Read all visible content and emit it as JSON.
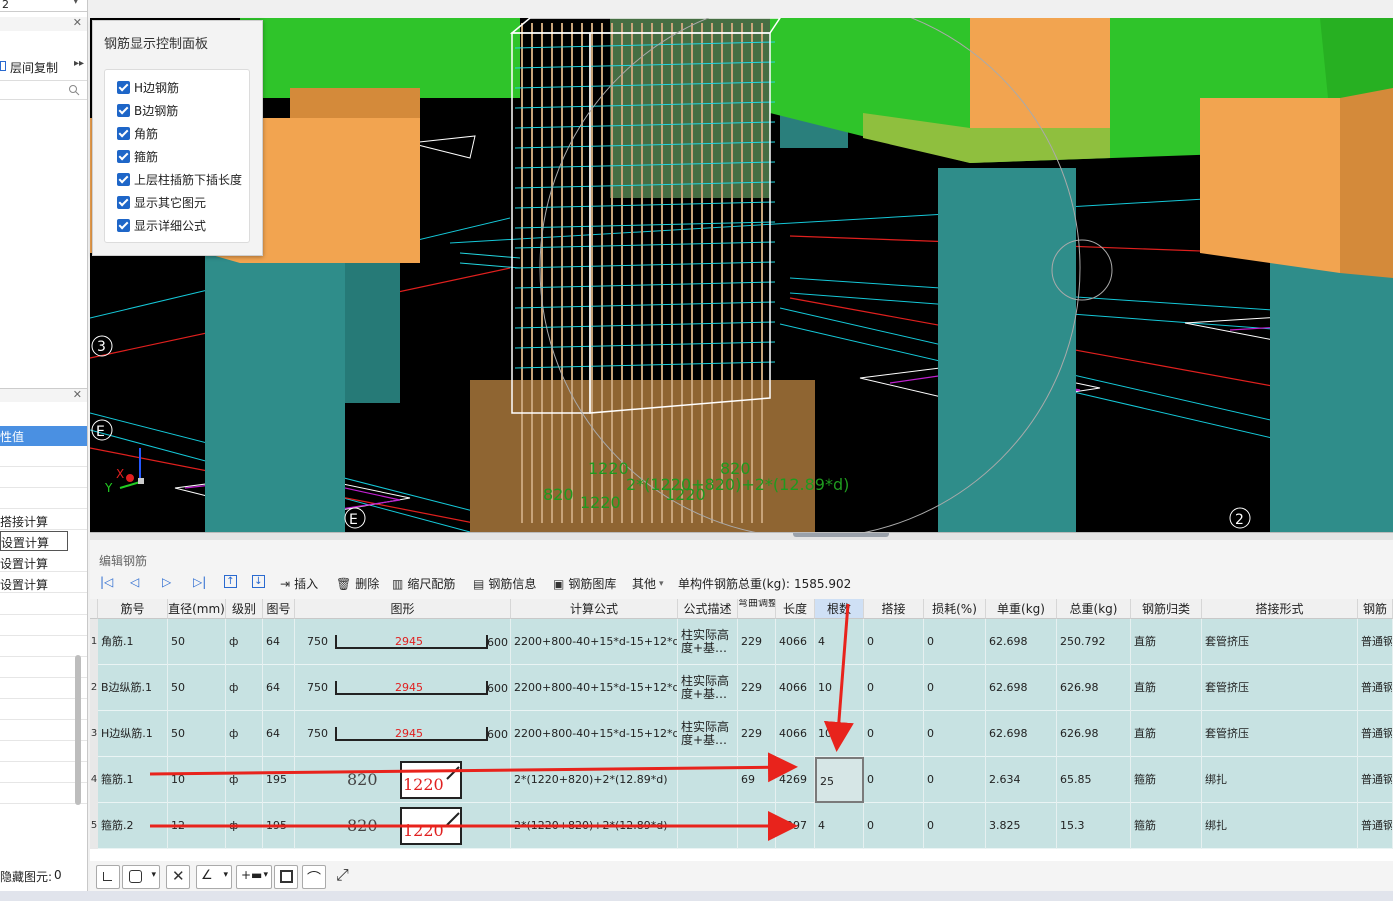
{
  "left_panel": {
    "top_select_value": "2",
    "floor_copy_label": "层间复制",
    "prop_header": "性值",
    "prop_items": [
      "搭接计算",
      "设置计算",
      "设置计算",
      "设置计算"
    ],
    "hidden_elements_label": "隐藏图元:",
    "hidden_elements_count": "0"
  },
  "viewport": {
    "axis_labels": [
      "3",
      "E",
      "E",
      "2"
    ],
    "dimension_labels": [
      "1220",
      "820",
      "820",
      "1220",
      "1220",
      "2*(1220+820)+2*(12.89*d)"
    ],
    "gizmo": {
      "x": "X",
      "y": "Y"
    }
  },
  "control_panel": {
    "title": "钢筋显示控制面板",
    "options": [
      {
        "label": "H边钢筋",
        "checked": true
      },
      {
        "label": "B边钢筋",
        "checked": true
      },
      {
        "label": "角筋",
        "checked": true
      },
      {
        "label": "箍筋",
        "checked": true
      },
      {
        "label": "上层柱插筋下插长度",
        "checked": true
      },
      {
        "label": "显示其它图元",
        "checked": true
      },
      {
        "label": "显示详细公式",
        "checked": true
      }
    ]
  },
  "editor": {
    "title": "编辑钢筋",
    "toolbar": {
      "insert": "插入",
      "delete": "删除",
      "scale_rebar": "缩尺配筋",
      "rebar_info": "钢筋信息",
      "rebar_library": "钢筋图库",
      "other": "其他",
      "total_weight_label": "单构件钢筋总重(kg):",
      "total_weight_value": "1585.902"
    },
    "columns": [
      "筋号",
      "直径(mm)",
      "级别",
      "图号",
      "图形",
      "计算公式",
      "公式描述",
      "弯曲调整",
      "长度",
      "根数",
      "搭接",
      "损耗(%)",
      "单重(kg)",
      "总重(kg)",
      "钢筋归类",
      "搭接形式",
      "钢筋"
    ],
    "rows": [
      {
        "no": "1",
        "name": "角筋.1",
        "dia": "50",
        "grade": "ф",
        "fig": "64",
        "shape_left": "750",
        "shape_mid": "2945",
        "shape_right": "600",
        "formula": "2200+800-40+15*d-15+12*d",
        "desc": "柱实际高度+基…",
        "bend": "229",
        "length": "4066",
        "count": "4",
        "lap": "0",
        "loss": "0",
        "unit": "62.698",
        "total": "250.792",
        "cls": "直筋",
        "lap_type": "套管挤压",
        "type": "普通钢"
      },
      {
        "no": "2",
        "name": "B边纵筋.1",
        "dia": "50",
        "grade": "ф",
        "fig": "64",
        "shape_left": "750",
        "shape_mid": "2945",
        "shape_right": "600",
        "formula": "2200+800-40+15*d-15+12*d",
        "desc": "柱实际高度+基…",
        "bend": "229",
        "length": "4066",
        "count": "10",
        "lap": "0",
        "loss": "0",
        "unit": "62.698",
        "total": "626.98",
        "cls": "直筋",
        "lap_type": "套管挤压",
        "type": "普通钢"
      },
      {
        "no": "3",
        "name": "H边纵筋.1",
        "dia": "50",
        "grade": "ф",
        "fig": "64",
        "shape_left": "750",
        "shape_mid": "2945",
        "shape_right": "600",
        "formula": "2200+800-40+15*d-15+12*d",
        "desc": "柱实际高度+基…",
        "bend": "229",
        "length": "4066",
        "count": "10",
        "lap": "0",
        "loss": "0",
        "unit": "62.698",
        "total": "626.98",
        "cls": "直筋",
        "lap_type": "套管挤压",
        "type": "普通钢"
      },
      {
        "no": "4",
        "name": "箍筋.1",
        "dia": "10",
        "grade": "ф",
        "fig": "195",
        "shape_left": "820",
        "shape_mid": "1220",
        "shape_right": "",
        "formula": "2*(1220+820)+2*(12.89*d)",
        "desc": "",
        "bend": "69",
        "length": "4269",
        "count": "25",
        "lap": "0",
        "loss": "0",
        "unit": "2.634",
        "total": "65.85",
        "cls": "箍筋",
        "lap_type": "绑扎",
        "type": "普通钢"
      },
      {
        "no": "5",
        "name": "箍筋.2",
        "dia": "12",
        "grade": "ф",
        "fig": "195",
        "shape_left": "820",
        "shape_mid": "1220",
        "shape_right": "",
        "formula": "2*(1220+820)+2*(12.89*d)",
        "desc": "",
        "bend": "",
        "length": "4297",
        "count": "4",
        "lap": "0",
        "loss": "0",
        "unit": "3.825",
        "total": "15.3",
        "cls": "箍筋",
        "lap_type": "绑扎",
        "type": "普通钢"
      }
    ]
  },
  "colors": {
    "beam_green": "#2fc42a",
    "pier_orange": "#f2a450",
    "column_teal": "#2f8d8a",
    "row_bg": "#c7e2e2",
    "annotation_red": "#e8231c",
    "dimension_green": "#1f9a1f"
  }
}
